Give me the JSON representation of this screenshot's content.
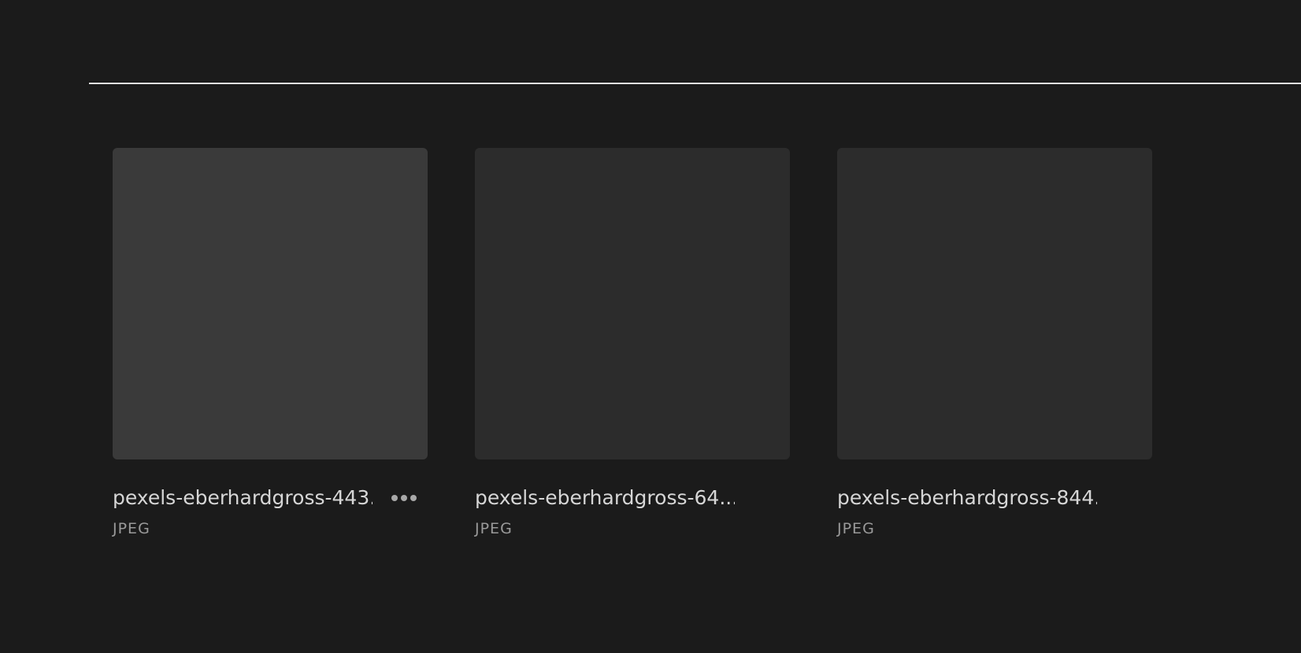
{
  "files": [
    {
      "name": "pexels-eberhardgross-443...",
      "type": "JPEG",
      "hovered": true,
      "more_icon": "ellipsis-icon"
    },
    {
      "name": "pexels-eberhardgross-64...",
      "type": "JPEG",
      "hovered": false
    },
    {
      "name": "pexels-eberhardgross-844...",
      "type": "JPEG",
      "hovered": false
    }
  ],
  "colors": {
    "background": "#1b1b1b",
    "divider": "#e3e3e3",
    "thumbnail": "#2c2c2c",
    "thumbnail_hover": "#3a3a3a",
    "filename": "#d6d6d6",
    "filetype": "#9a9a9a"
  }
}
